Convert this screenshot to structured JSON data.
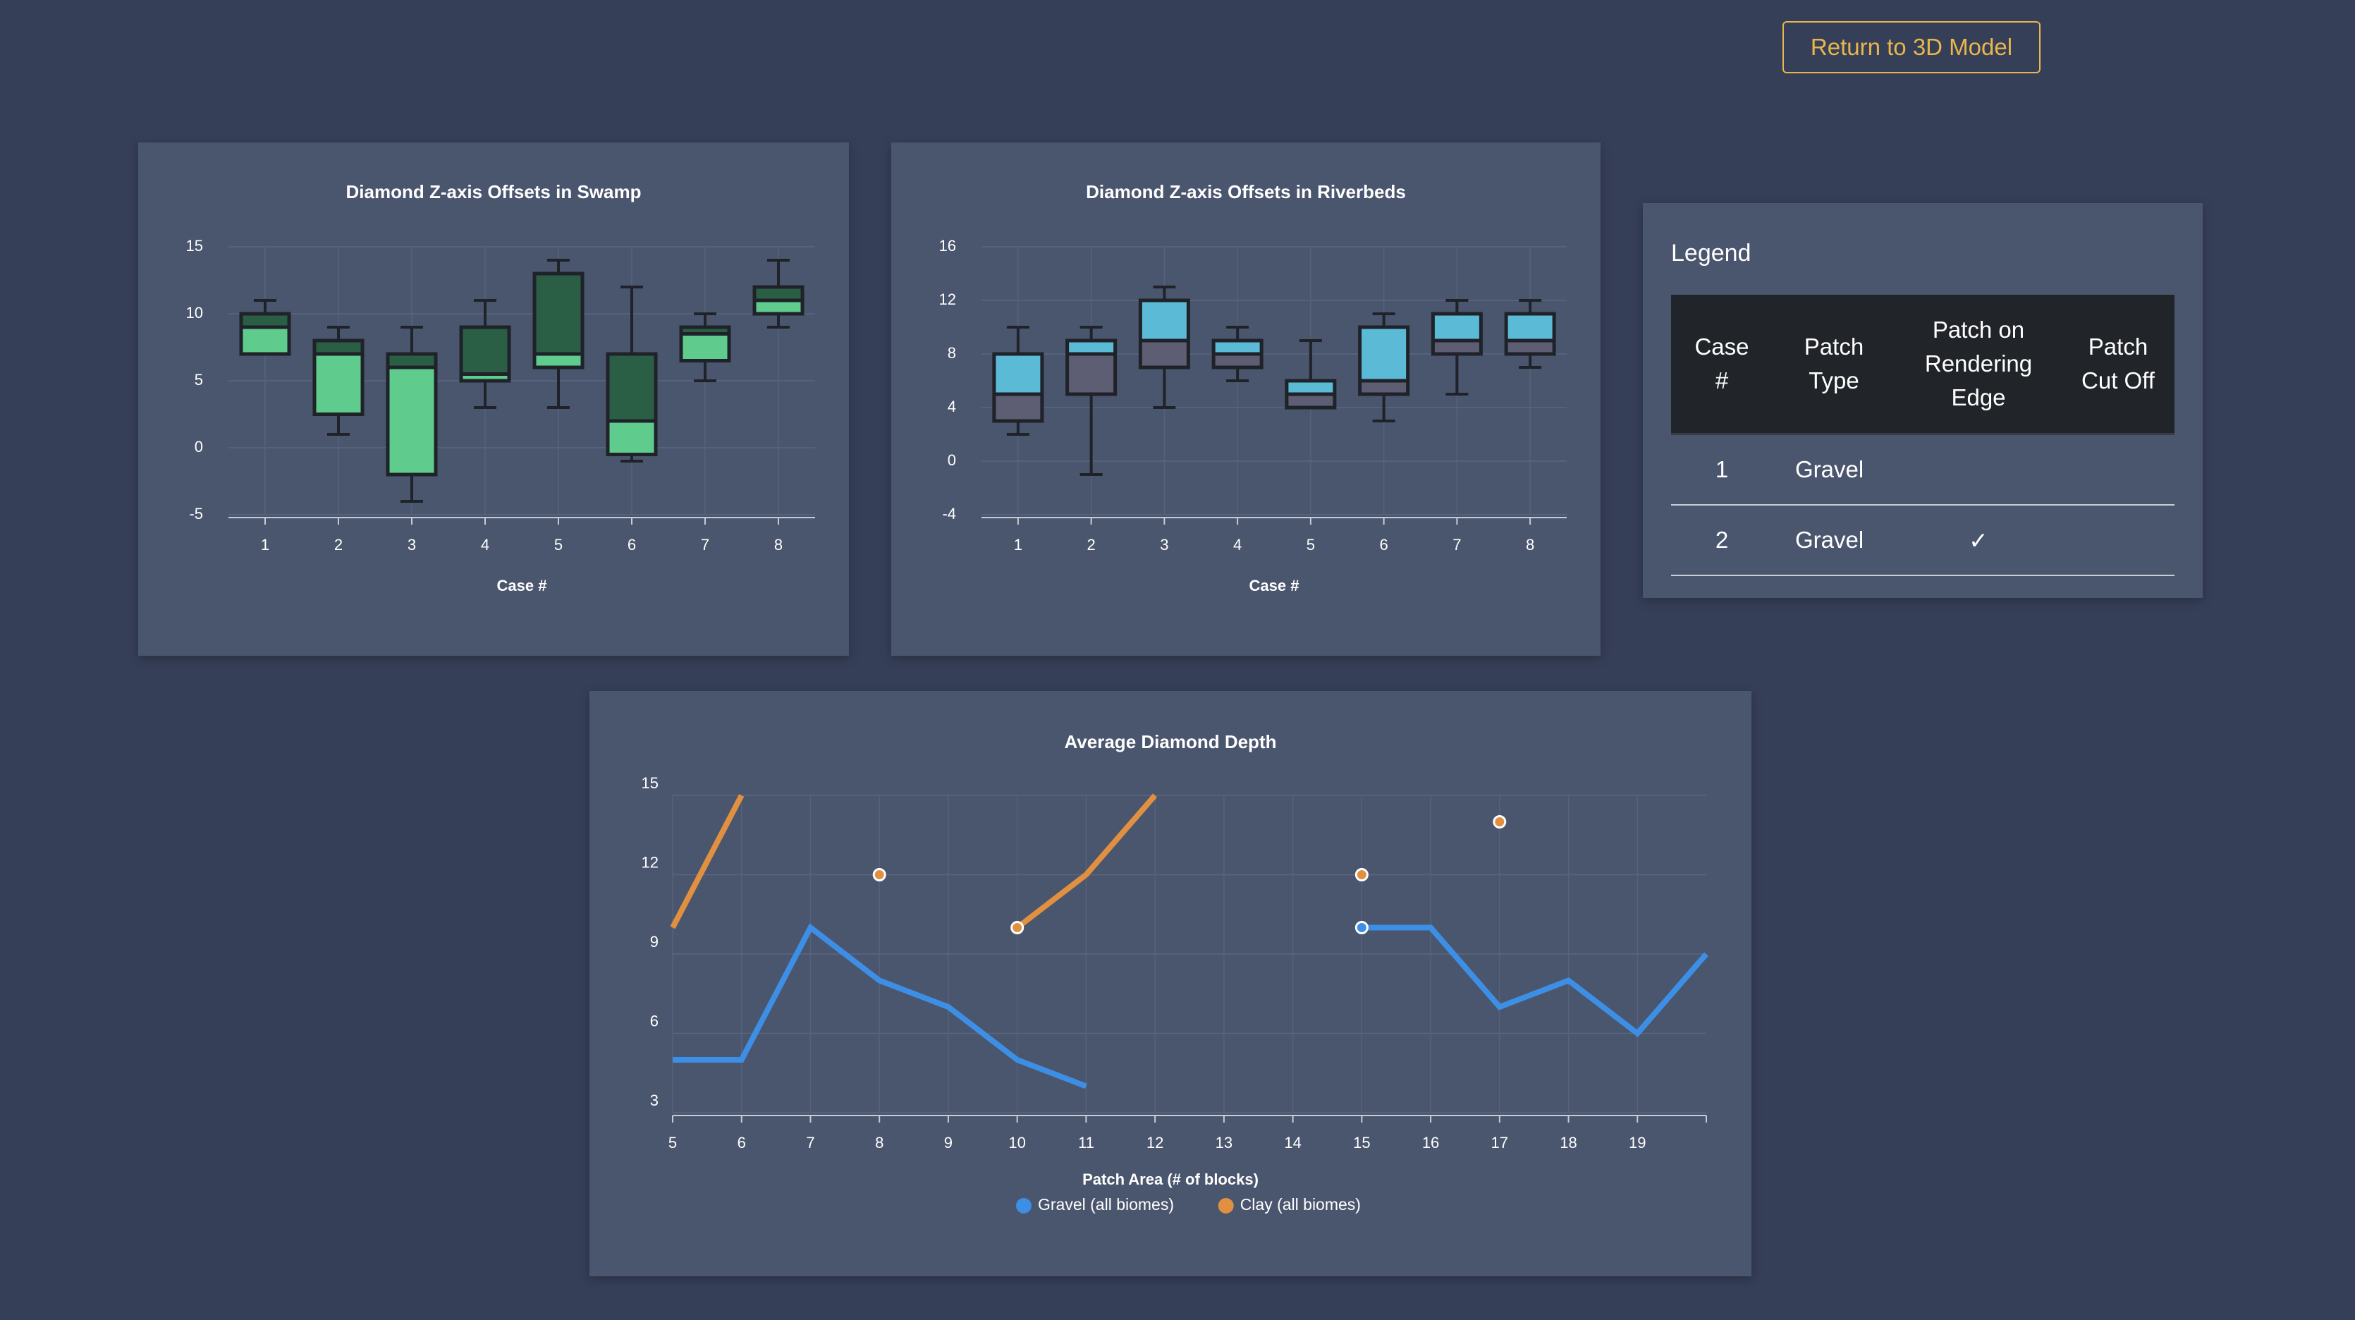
{
  "return_button": {
    "label": "Return to 3D Model"
  },
  "legend": {
    "title": "Legend",
    "headers": [
      [
        "Case",
        "#"
      ],
      [
        "Patch",
        "Type"
      ],
      [
        "Patch on",
        "Rendering",
        "Edge"
      ],
      [
        "Patch",
        "Cut Off"
      ]
    ],
    "rows": [
      {
        "case": "1",
        "type": "Gravel",
        "edge": "",
        "cutoff": ""
      },
      {
        "case": "2",
        "type": "Gravel",
        "edge": "✓",
        "cutoff": ""
      }
    ]
  },
  "chart_data": [
    {
      "type": "boxplot",
      "title": "Diamond Z-axis Offsets in Swamp",
      "xlabel": "Case #",
      "ylabel": "",
      "categories": [
        "1",
        "2",
        "3",
        "4",
        "5",
        "6",
        "7",
        "8"
      ],
      "yticks": [
        -5,
        0,
        5,
        10,
        15
      ],
      "ylim": [
        -5,
        15
      ],
      "grid": true,
      "colors": {
        "lower_box": "#5fcc8e",
        "upper_box": "#2a5e45",
        "stroke": "#1f2329"
      },
      "boxes": [
        {
          "min": 9,
          "q1": 7,
          "median": 9,
          "q3": 10,
          "max": 11
        },
        {
          "min": 1,
          "q1": 2.5,
          "median": 7,
          "q3": 8,
          "max": 9
        },
        {
          "min": -4,
          "q1": -2,
          "median": 6,
          "q3": 7,
          "max": 9
        },
        {
          "min": 3,
          "q1": 5,
          "median": 5.5,
          "q3": 9,
          "max": 11
        },
        {
          "min": 3,
          "q1": 6,
          "median": 7,
          "q3": 13,
          "max": 14
        },
        {
          "min": -1,
          "q1": -0.5,
          "median": 2,
          "q3": 7,
          "max": 12
        },
        {
          "min": 5,
          "q1": 6.5,
          "median": 8.5,
          "q3": 9,
          "max": 10
        },
        {
          "min": 9,
          "q1": 10,
          "median": 11,
          "q3": 12,
          "max": 14
        }
      ]
    },
    {
      "type": "boxplot",
      "title": "Diamond Z-axis Offsets in Riverbeds",
      "xlabel": "Case #",
      "ylabel": "",
      "categories": [
        "1",
        "2",
        "3",
        "4",
        "5",
        "6",
        "7",
        "8"
      ],
      "yticks": [
        -4,
        0,
        4,
        8,
        12,
        16
      ],
      "ylim": [
        -4,
        16
      ],
      "grid": true,
      "colors": {
        "lower_box": "#5d5e73",
        "upper_box": "#5bbad6",
        "stroke": "#1f2329"
      },
      "boxes": [
        {
          "min": 2,
          "q1": 3,
          "median": 5,
          "q3": 8,
          "max": 10
        },
        {
          "min": -1,
          "q1": 5,
          "median": 8,
          "q3": 9,
          "max": 10
        },
        {
          "min": 4,
          "q1": 7,
          "median": 9,
          "q3": 12,
          "max": 13
        },
        {
          "min": 6,
          "q1": 7,
          "median": 8,
          "q3": 9,
          "max": 10
        },
        {
          "min": 4,
          "q1": 4,
          "median": 5,
          "q3": 6,
          "max": 9
        },
        {
          "min": 3,
          "q1": 5,
          "median": 6,
          "q3": 10,
          "max": 11
        },
        {
          "min": 5,
          "q1": 8,
          "median": 9,
          "q3": 11,
          "max": 12
        },
        {
          "min": 7,
          "q1": 8,
          "median": 9,
          "q3": 11,
          "max": 12
        }
      ]
    },
    {
      "type": "line",
      "title": "Average Diamond Depth",
      "xlabel": "Patch Area (# of blocks)",
      "ylabel": "",
      "xticks": [
        5,
        6,
        7,
        8,
        9,
        10,
        11,
        12,
        13,
        14,
        15,
        16,
        17,
        18,
        19
      ],
      "xlim": [
        5,
        20
      ],
      "yticks": [
        3,
        6,
        9,
        12,
        15
      ],
      "ylim": [
        3,
        15
      ],
      "grid": true,
      "legend_position": "bottom-center",
      "series": [
        {
          "name": "Gravel (all biomes)",
          "color": "#3d8fe6",
          "points": [
            [
              5,
              5
            ],
            [
              6,
              5
            ],
            [
              7,
              10
            ],
            [
              8,
              8
            ],
            [
              9,
              7
            ],
            [
              10,
              5
            ],
            [
              11,
              4
            ],
            [
              12,
              null
            ],
            [
              13,
              null
            ],
            [
              14,
              null
            ],
            [
              15,
              10
            ],
            [
              16,
              10
            ],
            [
              17,
              7
            ],
            [
              18,
              8
            ],
            [
              19,
              6
            ],
            [
              20,
              9
            ]
          ]
        },
        {
          "name": "Clay (all biomes)",
          "color": "#e09040",
          "points": [
            [
              5,
              10
            ],
            [
              6,
              15
            ],
            [
              7,
              null
            ],
            [
              8,
              12
            ],
            [
              9,
              null
            ],
            [
              10,
              10
            ],
            [
              11,
              12
            ],
            [
              12,
              15
            ],
            [
              13,
              null
            ],
            [
              14,
              null
            ],
            [
              15,
              12
            ],
            [
              16,
              null
            ],
            [
              17,
              14
            ],
            [
              18,
              null
            ],
            [
              19,
              null
            ],
            [
              20,
              null
            ]
          ]
        }
      ]
    }
  ]
}
